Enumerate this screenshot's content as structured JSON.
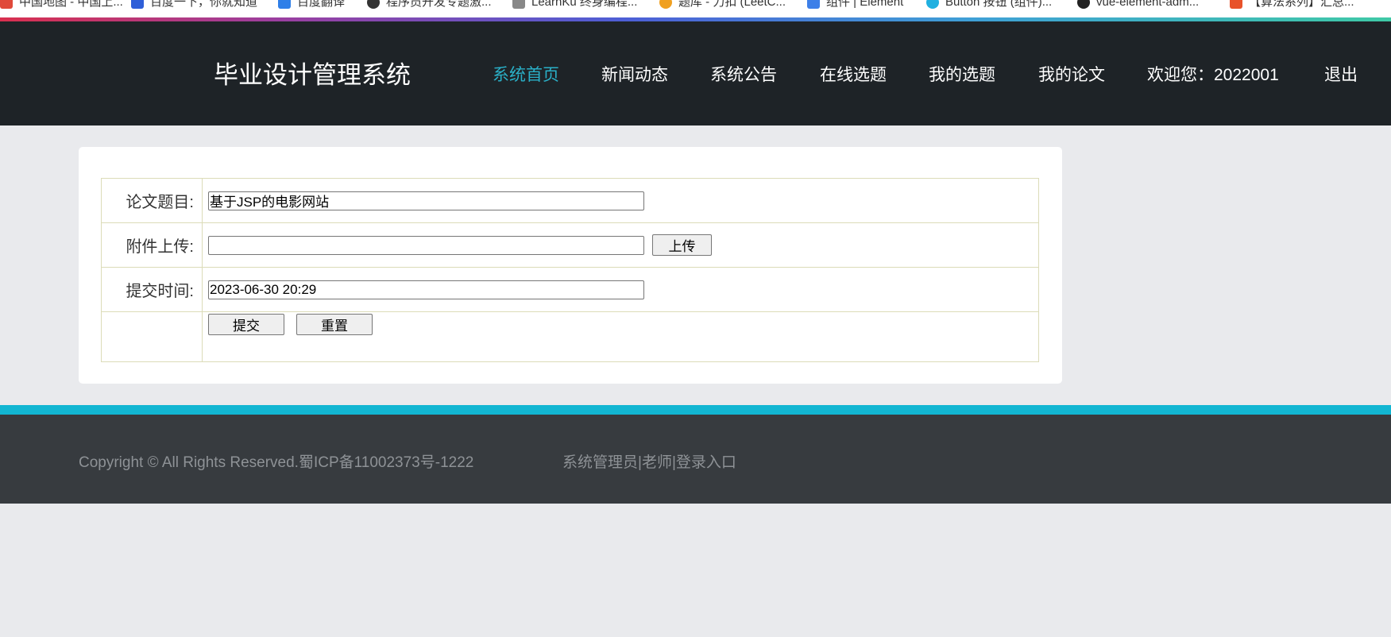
{
  "bookmarks": [
    {
      "label": "中国地图 - 中国上...",
      "color": "#e04a3a"
    },
    {
      "label": "百度一下，你就知道",
      "color": "#2f5fd8"
    },
    {
      "label": "百度翻译",
      "color": "#2f7fe8"
    },
    {
      "label": "程序员开发专题激...",
      "color": "#333333"
    },
    {
      "label": "LearnKu 终身编程...",
      "color": "#888888"
    },
    {
      "label": "题库 - 力扣 (LeetC...",
      "color": "#f0a020"
    },
    {
      "label": "组件 | Element",
      "color": "#3d7fe8"
    },
    {
      "label": "Button 按钮 (组件)...",
      "color": "#20b0e0"
    },
    {
      "label": "vue-element-adm...",
      "color": "#222222"
    },
    {
      "label": "【算法系列】汇总...",
      "color": "#e8522a"
    }
  ],
  "header": {
    "brand": "毕业设计管理系统",
    "nav": [
      {
        "label": "系统首页",
        "active": true
      },
      {
        "label": "新闻动态",
        "active": false
      },
      {
        "label": "系统公告",
        "active": false
      },
      {
        "label": "在线选题",
        "active": false
      },
      {
        "label": "我的选题",
        "active": false
      },
      {
        "label": "我的论文",
        "active": false
      },
      {
        "label": "欢迎您：2022001",
        "active": false
      },
      {
        "label": "退出",
        "active": false
      }
    ]
  },
  "form": {
    "title_label": "论文题目:",
    "title_value": "基于JSP的电影网站",
    "attachment_label": "附件上传:",
    "attachment_value": "",
    "upload_button": "上传",
    "time_label": "提交时间:",
    "time_value": "2023-06-30 20:29",
    "submit_button": "提交",
    "reset_button": "重置"
  },
  "footer": {
    "copyright": "Copyright © All Rights Reserved.蜀ICP备11002373号-1222",
    "links": [
      "系统管理员",
      "老师",
      "登录入口"
    ],
    "separator": "|"
  },
  "colors": {
    "header_bg": "#1e2327",
    "nav_active": "#2ab0c8",
    "footer_accent": "#12b6d2",
    "footer_bg": "#373b3f"
  }
}
